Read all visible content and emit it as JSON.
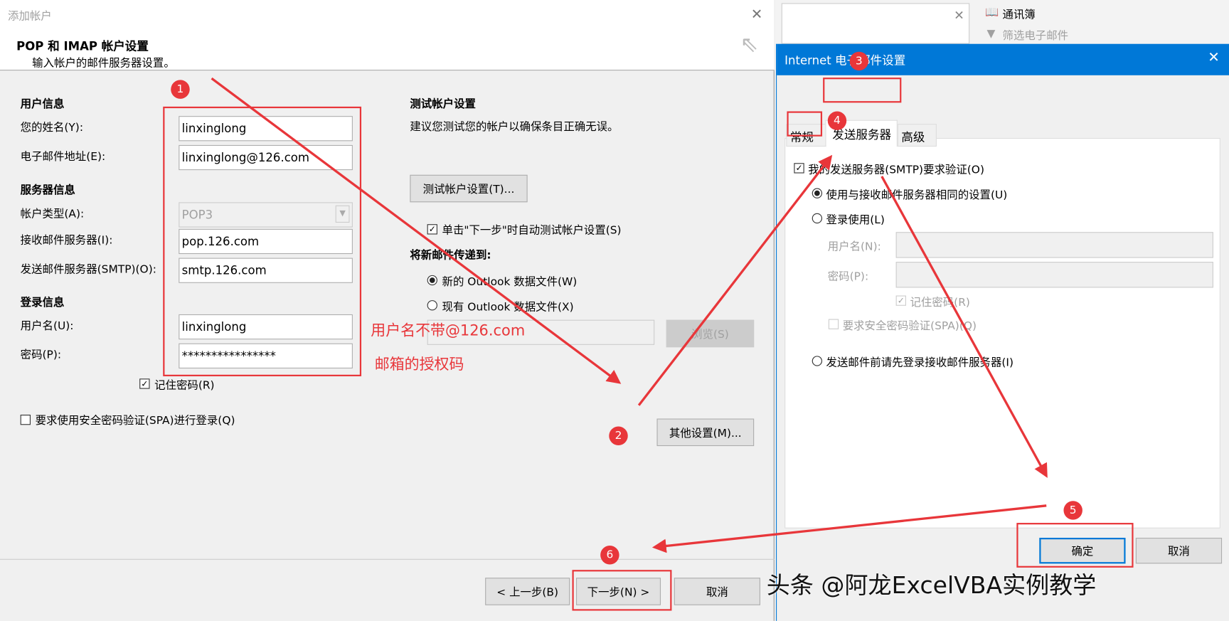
{
  "add_account": {
    "title": "添加帐户",
    "heading": "POP 和 IMAP 帐户设置",
    "subheading": "输入帐户的邮件服务器设置。",
    "user_info": {
      "section": "用户信息",
      "name_label": "您的姓名(Y):",
      "name_value": "linxinglong",
      "email_label": "电子邮件地址(E):",
      "email_value": "linxinglong@126.com"
    },
    "server_info": {
      "section": "服务器信息",
      "type_label": "帐户类型(A):",
      "type_value": "POP3",
      "incoming_label": "接收邮件服务器(I):",
      "incoming_value": "pop.126.com",
      "outgoing_label": "发送邮件服务器(SMTP)(O):",
      "outgoing_value": "smtp.126.com"
    },
    "login_info": {
      "section": "登录信息",
      "username_label": "用户名(U):",
      "username_value": "linxinglong",
      "password_label": "密码(P):",
      "password_value": "****************",
      "remember_label": "记住密码(R)",
      "spa_label": "要求使用安全密码验证(SPA)进行登录(Q)"
    },
    "test": {
      "section": "测试帐户设置",
      "description": "建议您测试您的帐户以确保条目正确无误。",
      "button": "测试帐户设置(T)...",
      "auto_test_label": "单击\"下一步\"时自动测试帐户设置(S)"
    },
    "deliver": {
      "section": "将新邮件传递到:",
      "new_file": "新的 Outlook 数据文件(W)",
      "existing_file": "现有 Outlook 数据文件(X)",
      "browse": "浏览(S)"
    },
    "more_settings": "其他设置(M)...",
    "back": "< 上一步(B)",
    "next": "下一步(N) >",
    "cancel": "取消"
  },
  "background": {
    "address_book": "通讯簿",
    "filter_email": "筛选电子邮件"
  },
  "internet_settings": {
    "title": "Internet 电子邮件设置",
    "tabs": [
      "常规",
      "发送服务器",
      "高级"
    ],
    "smtp_auth": "我的发送服务器(SMTP)要求验证(O)",
    "same_settings": "使用与接收邮件服务器相同的设置(U)",
    "login_with": "登录使用(L)",
    "username_label": "用户名(N):",
    "password_label": "密码(P):",
    "remember": "记住密码(R)",
    "spa": "要求安全密码验证(SPA)(Q)",
    "login_before_send": "发送邮件前请先登录接收邮件服务器(I)",
    "ok": "确定",
    "cancel": "取消"
  },
  "annotations": {
    "username_note": "用户名不带@126.com",
    "password_note": "邮箱的授权码",
    "steps": [
      "1",
      "2",
      "3",
      "4",
      "5",
      "6"
    ],
    "color": "#e8363a"
  },
  "watermark": "头条 @阿龙ExcelVBA实例教学"
}
